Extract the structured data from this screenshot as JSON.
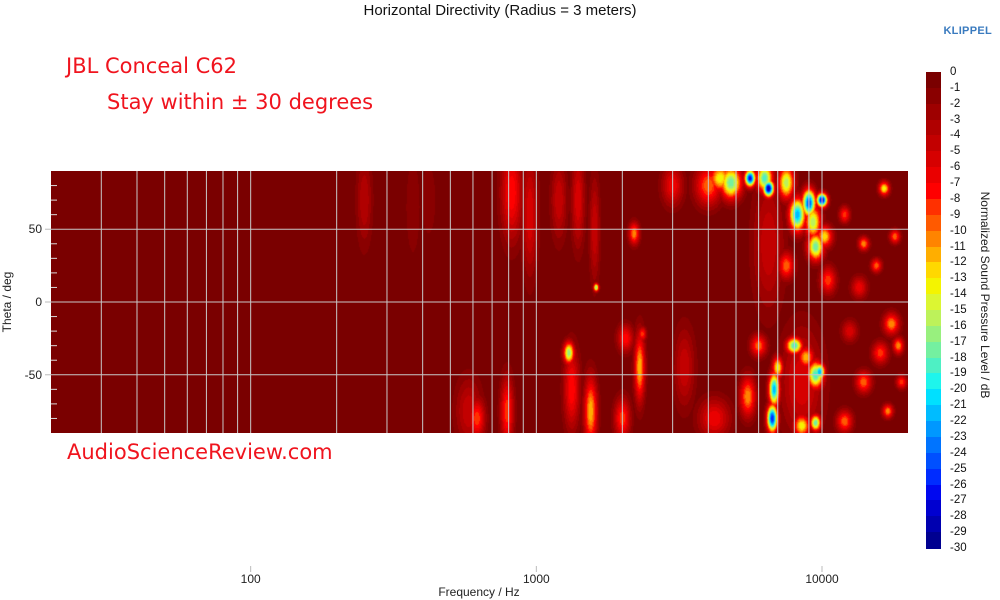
{
  "header": {
    "title": "Horizontal Directivity (Radius = 3 meters)",
    "brand": "KLIPPEL"
  },
  "annotations": {
    "model": "JBL Conceal C62",
    "note": "Stay within ± 30 degrees",
    "site": "AudioScienceReview.com"
  },
  "chart_data": {
    "type": "heatmap",
    "title": "Horizontal Directivity (Radius = 3 meters)",
    "xlabel": "Frequency / Hz",
    "ylabel": "Theta / deg",
    "xscale": "log",
    "xlim": [
      20,
      20000
    ],
    "ylim": [
      -90,
      90
    ],
    "x_ticks": [
      {
        "value": 100,
        "label": "100"
      },
      {
        "value": 1000,
        "label": "1000"
      },
      {
        "value": 10000,
        "label": "10000"
      }
    ],
    "y_ticks": [
      {
        "value": 50,
        "label": "50"
      },
      {
        "value": 0,
        "label": "0"
      },
      {
        "value": -50,
        "label": "-50"
      }
    ],
    "x_gridlines": [
      30,
      40,
      50,
      60,
      70,
      80,
      90,
      100,
      200,
      300,
      400,
      500,
      600,
      700,
      800,
      900,
      1000,
      2000,
      3000,
      4000,
      5000,
      6000,
      7000,
      8000,
      9000,
      10000
    ],
    "y_gridlines": [
      50,
      0,
      -50
    ],
    "y_minor_ticks": [
      80,
      70,
      60,
      40,
      30,
      20,
      10,
      -10,
      -20,
      -30,
      -40,
      -60,
      -70,
      -80
    ],
    "grid": true,
    "colorbar": {
      "label": "Normalized Sound Pressure Level / dB",
      "min": -30,
      "max": 0,
      "ticks": [
        0,
        -1,
        -2,
        -3,
        -4,
        -5,
        -6,
        -7,
        -8,
        -9,
        -10,
        -11,
        -12,
        -13,
        -14,
        -15,
        -16,
        -17,
        -18,
        -19,
        -20,
        -21,
        -22,
        -23,
        -24,
        -25,
        -26,
        -27,
        -28,
        -29,
        -30
      ],
      "colors": [
        "#7a0000",
        "#8a0000",
        "#9e0000",
        "#b00000",
        "#c20000",
        "#d60000",
        "#ea0000",
        "#ff0000",
        "#ff3000",
        "#ff5a00",
        "#ff8400",
        "#ffae00",
        "#ffd800",
        "#f4f400",
        "#dcf632",
        "#bdf25a",
        "#98f07e",
        "#74f0a0",
        "#4ef0c4",
        "#1ef5ec",
        "#00e0ff",
        "#00bcff",
        "#0098ff",
        "#0074ff",
        "#0050ff",
        "#002cff",
        "#0008f0",
        "#0000d0",
        "#0000b0",
        "#000090",
        "#000070"
      ]
    },
    "background_level_db": 0,
    "features": [
      {
        "f": 250,
        "theta": 70,
        "df": 0.03,
        "dt": 35,
        "db": -4
      },
      {
        "f": 370,
        "theta": 65,
        "df": 0.03,
        "dt": 40,
        "db": -2
      },
      {
        "f": 420,
        "theta": 70,
        "df": 0.03,
        "dt": 30,
        "db": -2
      },
      {
        "f": 580,
        "theta": -75,
        "df": 0.05,
        "dt": 25,
        "db": -5
      },
      {
        "f": 620,
        "theta": -80,
        "df": 0.03,
        "dt": 15,
        "db": -9
      },
      {
        "f": 820,
        "theta": 75,
        "df": 0.04,
        "dt": 35,
        "db": -8
      },
      {
        "f": 950,
        "theta": 60,
        "df": 0.03,
        "dt": 45,
        "db": -6
      },
      {
        "f": 790,
        "theta": -75,
        "df": 0.025,
        "dt": 25,
        "db": -9
      },
      {
        "f": 1200,
        "theta": 70,
        "df": 0.03,
        "dt": 30,
        "db": -5
      },
      {
        "f": 1400,
        "theta": 70,
        "df": 0.025,
        "dt": 35,
        "db": -6
      },
      {
        "f": 1300,
        "theta": -35,
        "df": 0.02,
        "dt": 8,
        "db": -17
      },
      {
        "f": 1330,
        "theta": -60,
        "df": 0.03,
        "dt": 30,
        "db": -8
      },
      {
        "f": 1550,
        "theta": -75,
        "df": 0.025,
        "dt": 25,
        "db": -12
      },
      {
        "f": 1620,
        "theta": 10,
        "df": 0.01,
        "dt": 3,
        "db": -17
      },
      {
        "f": 1600,
        "theta": 50,
        "df": 0.02,
        "dt": 40,
        "db": -5
      },
      {
        "f": 2200,
        "theta": 47,
        "df": 0.02,
        "dt": 8,
        "db": -11
      },
      {
        "f": 2300,
        "theta": -45,
        "df": 0.02,
        "dt": 25,
        "db": -12
      },
      {
        "f": 2350,
        "theta": -22,
        "df": 0.015,
        "dt": 5,
        "db": -9
      },
      {
        "f": 2050,
        "theta": -25,
        "df": 0.03,
        "dt": 10,
        "db": -8
      },
      {
        "f": 2000,
        "theta": -80,
        "df": 0.03,
        "dt": 15,
        "db": -9
      },
      {
        "f": 3000,
        "theta": 80,
        "df": 0.04,
        "dt": 15,
        "db": -7
      },
      {
        "f": 3300,
        "theta": -45,
        "df": 0.04,
        "dt": 30,
        "db": -5
      },
      {
        "f": 4000,
        "theta": 80,
        "df": 0.05,
        "dt": 15,
        "db": -10
      },
      {
        "f": 4400,
        "theta": 85,
        "df": 0.04,
        "dt": 10,
        "db": -14
      },
      {
        "f": 4800,
        "theta": 82,
        "df": 0.04,
        "dt": 12,
        "db": -18
      },
      {
        "f": 5600,
        "theta": 85,
        "df": 0.02,
        "dt": 6,
        "db": -27
      },
      {
        "f": 6500,
        "theta": 78,
        "df": 0.02,
        "dt": 6,
        "db": -29
      },
      {
        "f": 6300,
        "theta": 85,
        "df": 0.03,
        "dt": 10,
        "db": -19
      },
      {
        "f": 7500,
        "theta": 82,
        "df": 0.03,
        "dt": 12,
        "db": -16
      },
      {
        "f": 8200,
        "theta": 60,
        "df": 0.03,
        "dt": 12,
        "db": -22
      },
      {
        "f": 9000,
        "theta": 68,
        "df": 0.025,
        "dt": 10,
        "db": -25
      },
      {
        "f": 9300,
        "theta": 55,
        "df": 0.03,
        "dt": 12,
        "db": -16
      },
      {
        "f": 9500,
        "theta": 38,
        "df": 0.03,
        "dt": 10,
        "db": -18
      },
      {
        "f": 10000,
        "theta": 70,
        "df": 0.02,
        "dt": 5,
        "db": -28
      },
      {
        "f": 10200,
        "theta": 45,
        "df": 0.03,
        "dt": 8,
        "db": -13
      },
      {
        "f": 6500,
        "theta": 40,
        "df": 0.06,
        "dt": 50,
        "db": -5
      },
      {
        "f": 7500,
        "theta": 25,
        "df": 0.03,
        "dt": 10,
        "db": -10
      },
      {
        "f": 10500,
        "theta": 15,
        "df": 0.03,
        "dt": 10,
        "db": -9
      },
      {
        "f": 6000,
        "theta": -30,
        "df": 0.03,
        "dt": 8,
        "db": -10
      },
      {
        "f": 6800,
        "theta": -60,
        "df": 0.02,
        "dt": 12,
        "db": -22
      },
      {
        "f": 6700,
        "theta": -80,
        "df": 0.02,
        "dt": 10,
        "db": -26
      },
      {
        "f": 7000,
        "theta": -45,
        "df": 0.02,
        "dt": 8,
        "db": -14
      },
      {
        "f": 8000,
        "theta": -30,
        "df": 0.03,
        "dt": 6,
        "db": -19
      },
      {
        "f": 8800,
        "theta": -38,
        "df": 0.03,
        "dt": 8,
        "db": -12
      },
      {
        "f": 9500,
        "theta": -50,
        "df": 0.03,
        "dt": 10,
        "db": -19
      },
      {
        "f": 9800,
        "theta": -48,
        "df": 0.02,
        "dt": 6,
        "db": -22
      },
      {
        "f": 8500,
        "theta": -85,
        "df": 0.03,
        "dt": 8,
        "db": -14
      },
      {
        "f": 9500,
        "theta": -83,
        "df": 0.02,
        "dt": 6,
        "db": -18
      },
      {
        "f": 8500,
        "theta": -55,
        "df": 0.08,
        "dt": 40,
        "db": -6
      },
      {
        "f": 4200,
        "theta": -80,
        "df": 0.06,
        "dt": 15,
        "db": -7
      },
      {
        "f": 5500,
        "theta": -65,
        "df": 0.03,
        "dt": 15,
        "db": -11
      },
      {
        "f": 12000,
        "theta": 60,
        "df": 0.02,
        "dt": 6,
        "db": -9
      },
      {
        "f": 14000,
        "theta": 40,
        "df": 0.02,
        "dt": 5,
        "db": -11
      },
      {
        "f": 15500,
        "theta": 25,
        "df": 0.02,
        "dt": 5,
        "db": -10
      },
      {
        "f": 16500,
        "theta": 78,
        "df": 0.02,
        "dt": 5,
        "db": -14
      },
      {
        "f": 18000,
        "theta": 45,
        "df": 0.02,
        "dt": 5,
        "db": -10
      },
      {
        "f": 17500,
        "theta": -15,
        "df": 0.03,
        "dt": 8,
        "db": -11
      },
      {
        "f": 16000,
        "theta": -35,
        "df": 0.03,
        "dt": 8,
        "db": -9
      },
      {
        "f": 18500,
        "theta": -30,
        "df": 0.02,
        "dt": 6,
        "db": -11
      },
      {
        "f": 14000,
        "theta": -55,
        "df": 0.03,
        "dt": 8,
        "db": -10
      },
      {
        "f": 17000,
        "theta": -75,
        "df": 0.02,
        "dt": 5,
        "db": -11
      },
      {
        "f": 12000,
        "theta": -82,
        "df": 0.03,
        "dt": 8,
        "db": -10
      },
      {
        "f": 19000,
        "theta": -55,
        "df": 0.02,
        "dt": 5,
        "db": -9
      },
      {
        "f": 13500,
        "theta": 10,
        "df": 0.03,
        "dt": 8,
        "db": -7
      },
      {
        "f": 12500,
        "theta": -20,
        "df": 0.03,
        "dt": 8,
        "db": -6
      }
    ]
  }
}
